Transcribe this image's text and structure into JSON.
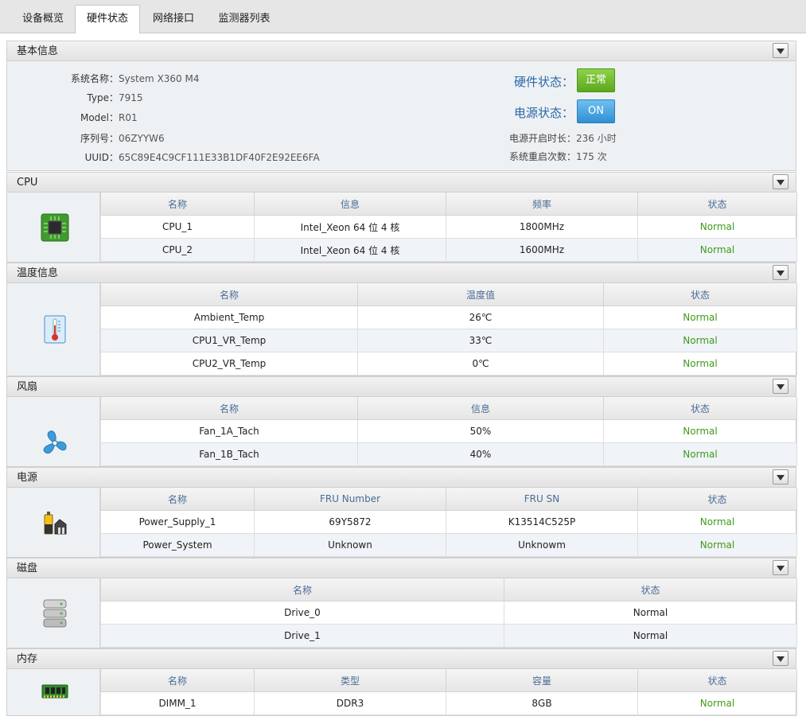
{
  "tabs": [
    "设备概览",
    "硬件状态",
    "网络接口",
    "监测器列表"
  ],
  "basic": {
    "title": "基本信息",
    "rows": [
      {
        "label": "系统名称：",
        "value": "System X360 M4"
      },
      {
        "label": "Type：",
        "value": "7915"
      },
      {
        "label": "Model：",
        "value": "R01"
      },
      {
        "label": "序列号：",
        "value": "06ZYYW6"
      },
      {
        "label": "UUID：",
        "value": "65C89E4C9CF111E33B1DF40F2E92EE6FA"
      }
    ],
    "hw_status_label": "硬件状态：",
    "hw_status_value": "正常",
    "power_status_label": "电源状态：",
    "power_status_value": "ON",
    "uptime_label": "电源开启时长：",
    "uptime_value": "236 小时",
    "reboot_label": "系统重启次数：",
    "reboot_value": "175 次"
  },
  "cpu": {
    "title": "CPU",
    "headers": [
      "名称",
      "信息",
      "频率",
      "状态"
    ],
    "rows": [
      [
        "CPU_1",
        "Intel_Xeon 64 位 4 核",
        "1800MHz",
        "Normal"
      ],
      [
        "CPU_2",
        "Intel_Xeon 64 位 4 核",
        "1600MHz",
        "Normal"
      ]
    ]
  },
  "temp": {
    "title": "温度信息",
    "headers": [
      "名称",
      "温度值",
      "状态"
    ],
    "rows": [
      [
        "Ambient_Temp",
        "26℃",
        "Normal"
      ],
      [
        "CPU1_VR_Temp",
        "33℃",
        "Normal"
      ],
      [
        "CPU2_VR_Temp",
        "0℃",
        "Normal"
      ]
    ]
  },
  "fan": {
    "title": "风扇",
    "headers": [
      "名称",
      "信息",
      "状态"
    ],
    "rows": [
      [
        "Fan_1A_Tach",
        "50%",
        "Normal"
      ],
      [
        "Fan_1B_Tach",
        "40%",
        "Normal"
      ]
    ]
  },
  "power": {
    "title": "电源",
    "headers": [
      "名称",
      "FRU Number",
      "FRU SN",
      "状态"
    ],
    "rows": [
      [
        "Power_Supply_1",
        "69Y5872",
        "K13514C525P",
        "Normal"
      ],
      [
        "Power_System",
        "Unknown",
        "Unknowm",
        "Normal"
      ]
    ]
  },
  "disk": {
    "title": "磁盘",
    "headers": [
      "名称",
      "状态"
    ],
    "rows": [
      [
        "Drive_0",
        "Normal"
      ],
      [
        "Drive_1",
        "Normal"
      ]
    ]
  },
  "memory": {
    "title": "内存",
    "headers": [
      "名称",
      "类型",
      "容量",
      "状态"
    ],
    "rows": [
      [
        "DIMM_1",
        "DDR3",
        "8GB",
        "Normal"
      ]
    ]
  },
  "colors": {
    "normal_green": "#3f9a1b",
    "header_blue": "#4a6c96",
    "status_label_blue": "#2a68a8"
  }
}
